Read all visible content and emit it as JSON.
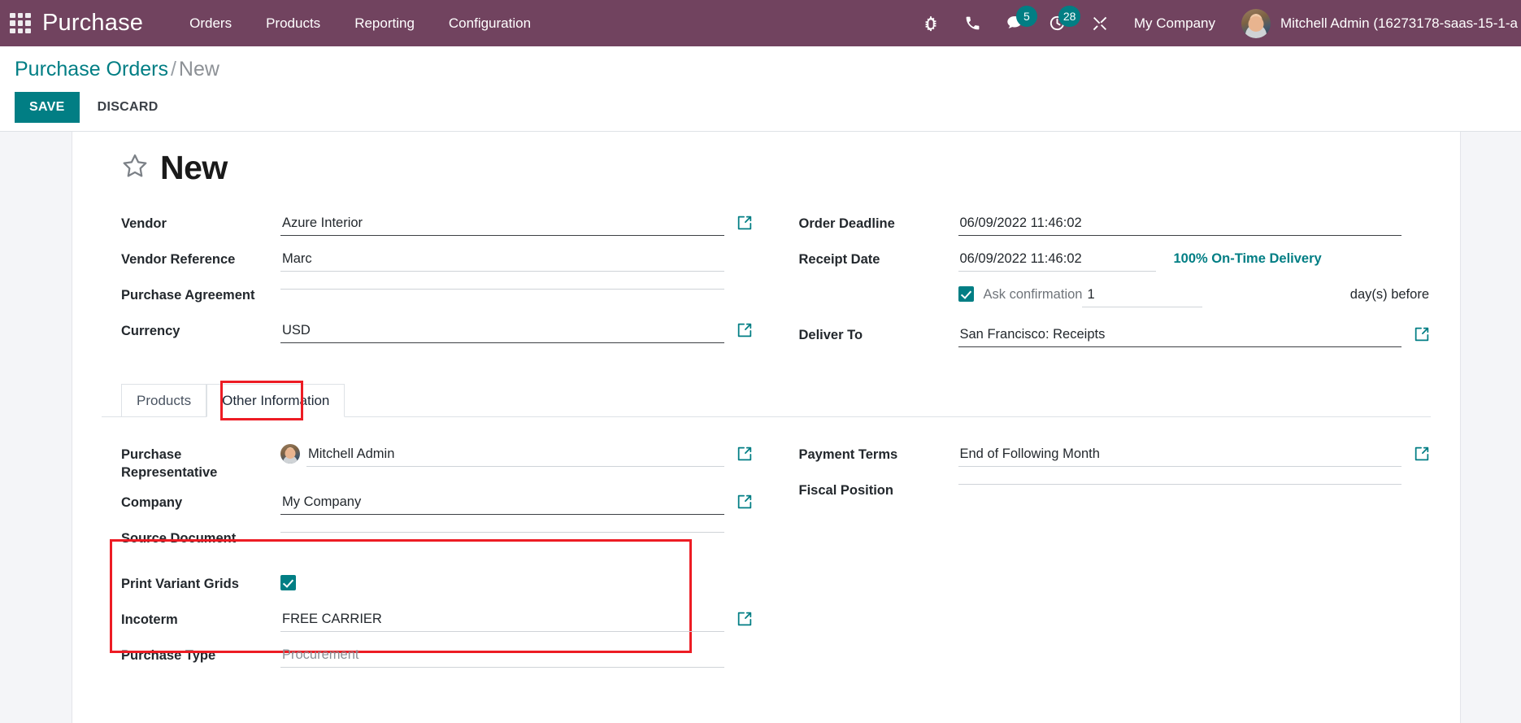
{
  "navbar": {
    "apps_icon": "apps-grid-icon",
    "brand": "Purchase",
    "menu": [
      {
        "label": "Orders"
      },
      {
        "label": "Products"
      },
      {
        "label": "Reporting"
      },
      {
        "label": "Configuration"
      }
    ],
    "sys_icons": [
      {
        "name": "bug-icon",
        "badge": null
      },
      {
        "name": "phone-icon",
        "badge": null
      },
      {
        "name": "messages-icon",
        "badge": "5"
      },
      {
        "name": "activities-clock-icon",
        "badge": "28"
      },
      {
        "name": "tools-icon",
        "badge": null
      }
    ],
    "company": "My Company",
    "user_name": "Mitchell Admin (16273178-saas-15-1-a",
    "avatar": "user-avatar"
  },
  "control_panel": {
    "breadcrumb_root": "Purchase Orders",
    "breadcrumb_sep": "/",
    "breadcrumb_current": "New",
    "save_label": "SAVE",
    "discard_label": "DISCARD"
  },
  "record": {
    "star_icon": "favorite-star-icon",
    "title": "New"
  },
  "header_form": {
    "left": [
      {
        "label": "Vendor",
        "value": "Azure Interior",
        "caret": "dark",
        "ext_link": true,
        "underline": "strong"
      },
      {
        "label": "Vendor Reference",
        "value": "Marc",
        "caret": "none",
        "ext_link": false,
        "underline": "light"
      },
      {
        "label": "Purchase Agreement",
        "value": "",
        "caret": "grey",
        "ext_link": false,
        "underline": "light"
      },
      {
        "label": "Currency",
        "value": "USD",
        "caret": "dark",
        "ext_link": true,
        "underline": "strong"
      }
    ],
    "right": {
      "order_deadline_label": "Order Deadline",
      "order_deadline_value": "06/09/2022 11:46:02",
      "receipt_date_label": "Receipt Date",
      "receipt_date_value": "06/09/2022 11:46:02",
      "on_time_delivery": "100% On-Time Delivery",
      "ask_confirmation_label": "Ask confirmation",
      "ask_confirmation_checked": true,
      "ask_confirmation_days": "1",
      "days_before_label": "day(s) before",
      "deliver_to_label": "Deliver To",
      "deliver_to_value": "San Francisco: Receipts"
    }
  },
  "notebook": {
    "tabs": [
      {
        "label": "Products",
        "active": false
      },
      {
        "label": "Other Information",
        "active": true
      }
    ],
    "highlight_color": "#ed1c24"
  },
  "other_information": {
    "left": {
      "purchase_representative_label": "Purchase Representative",
      "purchase_representative_value": "Mitchell Admin",
      "company_label": "Company",
      "company_value": "My Company",
      "source_document_label": "Source Document",
      "source_document_value": "",
      "print_variant_grids_label": "Print Variant Grids",
      "print_variant_grids_checked": true,
      "incoterm_label": "Incoterm",
      "incoterm_value": "FREE CARRIER",
      "purchase_type_label": "Purchase Type",
      "purchase_type_value": "Procurement"
    },
    "right": {
      "payment_terms_label": "Payment Terms",
      "payment_terms_value": "End of Following Month",
      "fiscal_position_label": "Fiscal Position",
      "fiscal_position_value": ""
    }
  },
  "colors": {
    "navbar_bg": "#71435f",
    "accent_teal": "#017e84",
    "highlight_red": "#ed1c24",
    "page_bg": "#f4f5f8"
  }
}
